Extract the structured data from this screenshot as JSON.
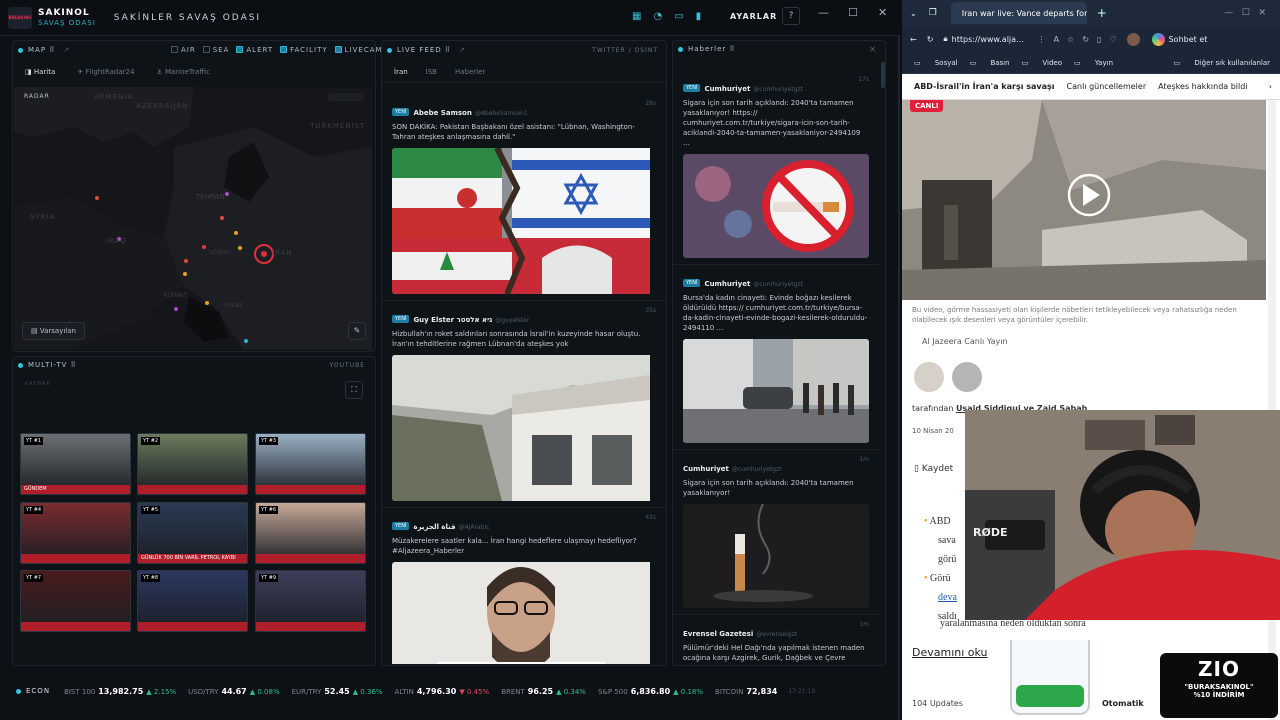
{
  "app": {
    "logo_text": "BREAKING",
    "brand_name": "SAKINOL",
    "brand_sub": "SAVAŞ ODASI",
    "title": "SAKİNLER SAVAŞ ODASI",
    "settings_label": "AYARLAR",
    "help_label": "?"
  },
  "map_panel": {
    "header": "MAP ⠿",
    "filters": [
      {
        "label": "AIR",
        "checked": false
      },
      {
        "label": "SEA",
        "checked": false
      },
      {
        "label": "ALERT",
        "checked": true
      },
      {
        "label": "FACILITY",
        "checked": true
      },
      {
        "label": "LIVECAM",
        "checked": true
      }
    ],
    "tabs": [
      "Harita",
      "FlightRadar24",
      "MarineTraffic"
    ],
    "radar_label": "RADAR",
    "regions": [
      "ARMENIA",
      "AZERBAIJAN",
      "TURKMENIST",
      "TEHRAN",
      "SYRIA",
      "IRAQ",
      "IRAN",
      "Isfahan",
      "KUWAIT",
      "Shiraz"
    ],
    "default_label": "Varsayılan"
  },
  "multitv": {
    "header": "MULTI-TV ⠿",
    "source": "YOUTUBE",
    "sub": "KAYNAK",
    "channels": [
      {
        "label": "YT #1",
        "caption": "GÜNDEM",
        "bg": "#6c6f73"
      },
      {
        "label": "YT #2",
        "caption": "",
        "bg": "#6b7a5c"
      },
      {
        "label": "YT #3",
        "caption": "",
        "bg": "#9ab0c4"
      },
      {
        "label": "YT #4",
        "caption": "",
        "bg": "#7c2b2e"
      },
      {
        "label": "YT #5",
        "caption": "GÜNLÜK 700 BİN VARİL PETROL KAYBI",
        "bg": "#2a3a52"
      },
      {
        "label": "YT #6",
        "caption": "",
        "bg": "#c7a998"
      },
      {
        "label": "YT #7",
        "caption": "",
        "bg": "#4a1c1c"
      },
      {
        "label": "YT #8",
        "caption": "",
        "bg": "#2c3860"
      },
      {
        "label": "YT #9",
        "caption": "",
        "bg": "#3d3f5a"
      }
    ]
  },
  "live_feed": {
    "header": "LIVE FEED ⠿",
    "source": "TWITTER / OSINT",
    "tabs": [
      "İran",
      "İSB",
      "Haberler"
    ],
    "posts": [
      {
        "tag": "YENİ",
        "user": "Abebe Samson",
        "handle": "@AbebeSamson1",
        "age": "28s",
        "text": "SON DAKİKA: Pakistan Başbakanı özel asistanı: \"Lübnan, Washington-Tahran ateşkes anlaşmasına dahil.\""
      },
      {
        "tag": "YENİ",
        "user": "Guy Elster גיא אלסטר",
        "handle": "@guyelster",
        "age": "35s",
        "text": "Hizbullah'ın roket saldırıları sonrasında İsrail'in kuzeyinde hasar oluştu. İran'ın tehditlerine rağmen Lübnan'da ateşkes yok"
      },
      {
        "tag": "YENİ",
        "user": "قناة الجزيرة",
        "handle": "@AJArabic",
        "age": "42s",
        "text": "Müzakerelere saatler kala... İran hangi hedeflere ulaşmayı hedefliyor? #Aljazeera_Haberler"
      }
    ]
  },
  "haberler": {
    "header": "Haberler ⠿",
    "posts": [
      {
        "tag": "YENİ",
        "user": "Cumhuriyet",
        "handle": "@cumhuriyetgzt",
        "age": "17s",
        "text": "Sigara için son tarih açıklandı: 2040'ta tamamen yasaklanıyor! https:// cumhuriyet.com.tr/turkiye/sigara-icin-son-tarih-aciklandi-2040-ta-tamamen-yasaklaniyor-2494109 …"
      },
      {
        "tag": "YENİ",
        "user": "Cumhuriyet",
        "handle": "@cumhuriyetgzt",
        "age": "",
        "text": "Bursa'da kadın cinayeti: Evinde boğazı kesilerek öldürüldü https:// cumhuriyet.com.tr/turkiye/bursa-da-kadin-cinayeti-evinde-bogazi-kesilerek-olduruldu-2494110 …"
      },
      {
        "tag": "",
        "user": "Cumhuriyet",
        "handle": "@cumhuriyetgzt",
        "age": "1m",
        "text": "Sigara için son tarih açıklandı: 2040'ta tamamen yasaklanıyor!"
      },
      {
        "tag": "",
        "user": "Evrensel Gazetesi",
        "handle": "@evrenselgzt",
        "age": "1m",
        "text": "Pülümür'deki Hel Dağı'nda yapılmak istenen maden ocağına karşı Azgirek, Gurik, Dağbek ve Çevre Köyleri Platformu topladığı 2 bine yakın imzayı Çevre Şehircilik İl"
      }
    ]
  },
  "ticker": {
    "label": "ECON",
    "items": [
      {
        "name": "BIST 100",
        "value": "13,982.75",
        "change": "▲ 2.15%",
        "up": true
      },
      {
        "name": "USD/TRY",
        "value": "44.67",
        "change": "▲ 0.08%",
        "up": true
      },
      {
        "name": "EUR/TRY",
        "value": "52.45",
        "change": "▲ 0.36%",
        "up": true
      },
      {
        "name": "ALTIN",
        "value": "4,796.30",
        "change": "▼ 0.45%",
        "up": false
      },
      {
        "name": "BRENT",
        "value": "96.25",
        "change": "▲ 0.34%",
        "up": true
      },
      {
        "name": "S&P 500",
        "value": "6,836.80",
        "change": "▲ 0.18%",
        "up": true
      },
      {
        "name": "BITCOIN",
        "value": "72,834",
        "change": "",
        "up": true
      }
    ],
    "time": "17:21:18"
  },
  "browser": {
    "tab_title": "Iran war live: Vance departs for tal",
    "url": "https://www.alja...",
    "profile_label": "Sohbet et",
    "bookmarks": [
      "Sosyal",
      "Basın",
      "Video",
      "Yayın"
    ],
    "other_bookmarks": "Diğer sık kullanılanlar",
    "nav": [
      "ABD-İsrail'in İran'a karşı savaşı",
      "Canlı güncellemeler",
      "Ateşkes hakkında bildi"
    ],
    "live_badge": "CANLI",
    "caption": "Bu video, görme hassasiyeti olan kişilerde nöbetleri tetikleyebilecek veya rahatsızlığa neden olabilecek ışık desenleri veya görüntüler içerebilir.",
    "source": "Al Jazeera Canlı Yayın",
    "byline_prefix": "tarafından",
    "authors": "Usaid Siddiqui ve Zaid Sabah",
    "date": "10 Nisan 20",
    "save": "Kaydet",
    "bullets": [
      "ABD",
      "sava",
      "görü",
      "Görü",
      "deva",
      "saldı"
    ],
    "continued": "yaralanmasına neden olduktan sonra",
    "read_more": "Devamını oku",
    "updates": "104 Updates",
    "otomatik": "Otomatik"
  },
  "webcam": {
    "mic_brand": "RØDE"
  },
  "promo": {
    "logo": "ZIO",
    "code": "\"BURAKSAKINOL\"",
    "discount": "%10 İNDİRİM"
  }
}
